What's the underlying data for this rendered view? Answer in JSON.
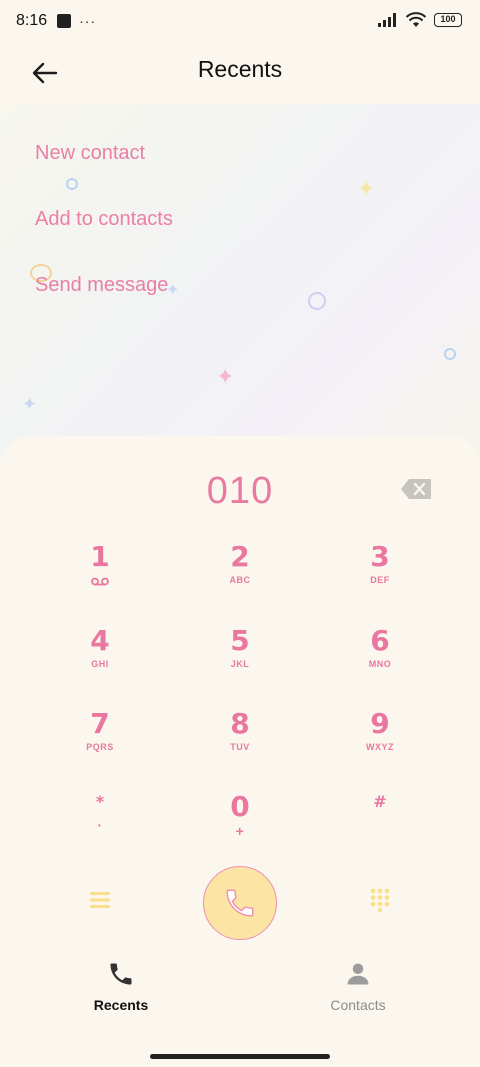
{
  "status_bar": {
    "time": "8:16",
    "dots": "···",
    "battery": "100"
  },
  "header": {
    "title": "Recents"
  },
  "menu": [
    {
      "label": "New contact"
    },
    {
      "label": "Add to contacts"
    },
    {
      "label": "Send message"
    }
  ],
  "dialer": {
    "number": "010",
    "keys": [
      {
        "digit": "1",
        "sub": "voicemail-icon"
      },
      {
        "digit": "2",
        "sub": "ABC"
      },
      {
        "digit": "3",
        "sub": "DEF"
      },
      {
        "digit": "4",
        "sub": "GHI"
      },
      {
        "digit": "5",
        "sub": "JKL"
      },
      {
        "digit": "6",
        "sub": "MNO"
      },
      {
        "digit": "7",
        "sub": "PQRS"
      },
      {
        "digit": "8",
        "sub": "TUV"
      },
      {
        "digit": "9",
        "sub": "WXYZ"
      },
      {
        "digit": "*",
        "sub": "·"
      },
      {
        "digit": "0",
        "sub": "+"
      },
      {
        "digit": "#",
        "sub": ""
      }
    ]
  },
  "bottom_nav": {
    "recents": "Recents",
    "contacts": "Contacts"
  },
  "colors": {
    "accent_pink": "#e9779f",
    "call_button_fill": "#fbe4a4",
    "yellow_icons": "#fbe08a"
  }
}
